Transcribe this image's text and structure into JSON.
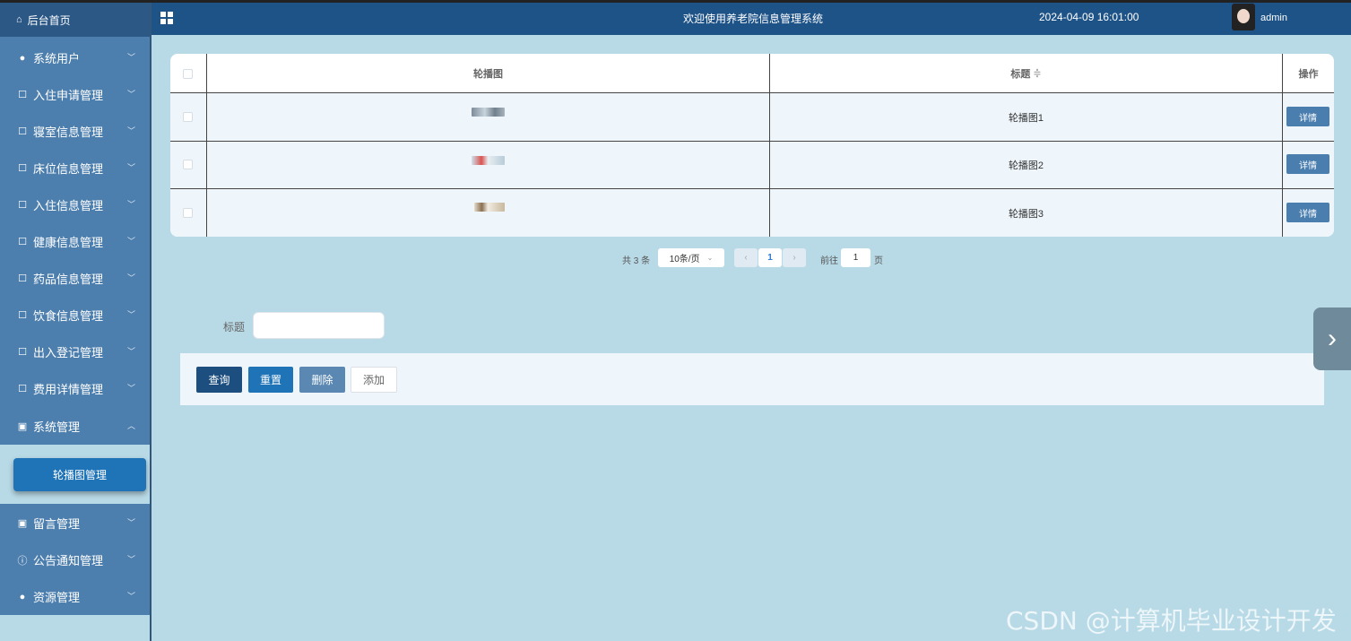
{
  "sidebar": {
    "home": "后台首页",
    "items": [
      {
        "label": "系统用户",
        "icon": "user-icon"
      },
      {
        "label": "入住申请管理",
        "icon": "edit-icon"
      },
      {
        "label": "寝室信息管理",
        "icon": "edit-icon"
      },
      {
        "label": "床位信息管理",
        "icon": "edit-icon"
      },
      {
        "label": "入住信息管理",
        "icon": "edit-icon"
      },
      {
        "label": "健康信息管理",
        "icon": "edit-icon"
      },
      {
        "label": "药品信息管理",
        "icon": "edit-icon"
      },
      {
        "label": "饮食信息管理",
        "icon": "edit-icon"
      },
      {
        "label": "出入登记管理",
        "icon": "edit-icon"
      },
      {
        "label": "费用详情管理",
        "icon": "edit-icon"
      },
      {
        "label": "系统管理",
        "icon": "picture-icon"
      },
      {
        "label": "留言管理",
        "icon": "picture-icon"
      },
      {
        "label": "公告通知管理",
        "icon": "info-icon"
      },
      {
        "label": "资源管理",
        "icon": "bulb-icon"
      }
    ],
    "submenu_active": "轮播图管理"
  },
  "header": {
    "title": "欢迎使用养老院信息管理系统",
    "datetime": "2024-04-09 16:01:00",
    "user": "admin"
  },
  "table": {
    "columns": [
      "轮播图",
      "标题",
      "操作"
    ],
    "sort_icon": "≑",
    "rows": [
      {
        "title": "轮播图1",
        "action": "详情"
      },
      {
        "title": "轮播图2",
        "action": "详情"
      },
      {
        "title": "轮播图3",
        "action": "详情"
      }
    ]
  },
  "pagination": {
    "total": "共 3 条",
    "page_size": "10条/页",
    "current_page": "1",
    "goto_label": "前往",
    "goto_value": "1",
    "page_suffix": "页"
  },
  "search": {
    "label": "标题",
    "placeholder": ""
  },
  "buttons": {
    "query": "查询",
    "reset": "重置",
    "delete": "删除",
    "add": "添加"
  },
  "watermark": "CSDN @计算机毕业设计开发",
  "colors": {
    "header": "#1e5388",
    "sidebar": "#4d7fae",
    "background": "#b8d9e6",
    "active_submenu": "#1f73b7"
  }
}
